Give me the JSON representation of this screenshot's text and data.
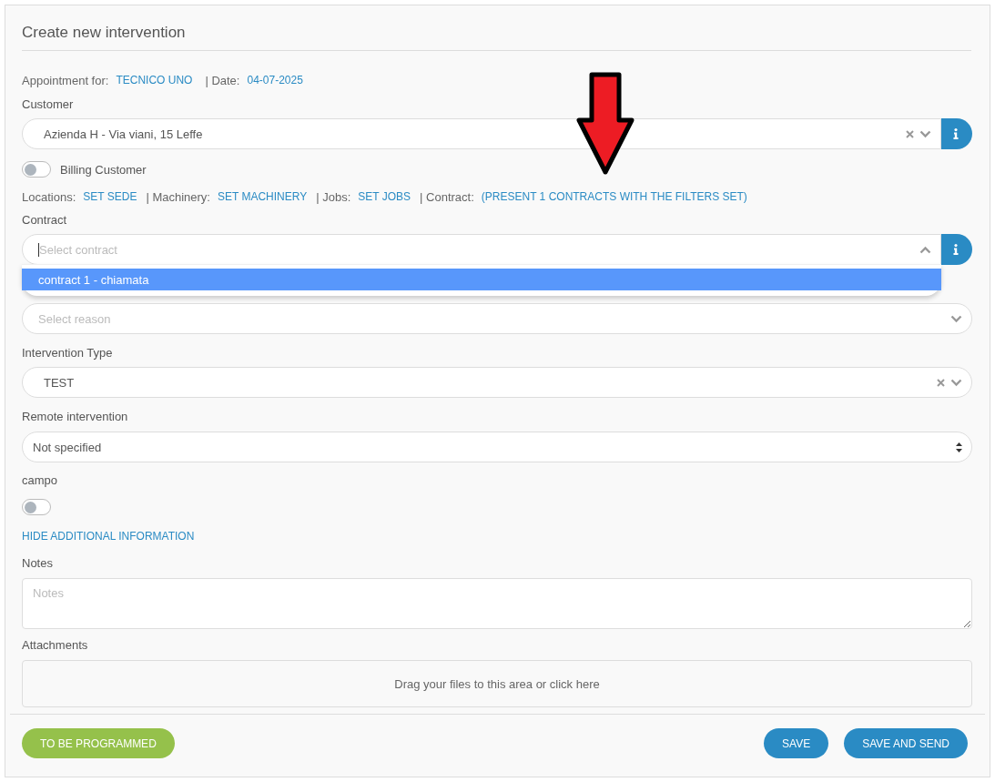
{
  "title": "Create new intervention",
  "appointment": {
    "label": "Appointment for:",
    "technician": "TECNICO UNO",
    "date_label": "| Date:",
    "date": "04-07-2025"
  },
  "customer": {
    "label": "Customer",
    "value": "Azienda H - Via viani, 15 Leffe"
  },
  "billing_customer": {
    "label": "Billing Customer",
    "on": false
  },
  "filters": [
    {
      "label": "Locations:",
      "link": "SET SEDE"
    },
    {
      "label": "| Machinery:",
      "link": "SET MACHINERY"
    },
    {
      "label": "| Jobs:",
      "link": "SET JOBS"
    },
    {
      "label": "| Contract:",
      "link": "(PRESENT 1 CONTRACTS WITH THE FILTERS SET)"
    }
  ],
  "contract": {
    "label": "Contract",
    "placeholder": "Select contract",
    "expanded": true,
    "options": [
      {
        "label": "contract 1 - chiamata",
        "selected": true
      }
    ]
  },
  "reason": {
    "placeholder": "Select reason"
  },
  "intervention_type": {
    "label": "Intervention Type",
    "value": "TEST"
  },
  "remote_intervention": {
    "label": "Remote intervention",
    "value": "Not specified"
  },
  "campo": {
    "label": "campo",
    "on": false
  },
  "additional_info_link": "HIDE ADDITIONAL INFORMATION",
  "notes": {
    "label": "Notes",
    "placeholder": "Notes"
  },
  "attachments": {
    "label": "Attachments",
    "dropzone_text": "Drag your files to this area or click here"
  },
  "buttons": [
    {
      "label": "TO BE PROGRAMMED",
      "kind": "status"
    },
    {
      "label": "SAVE",
      "kind": "primary"
    },
    {
      "label": "SAVE AND SEND",
      "kind": "primary"
    }
  ]
}
